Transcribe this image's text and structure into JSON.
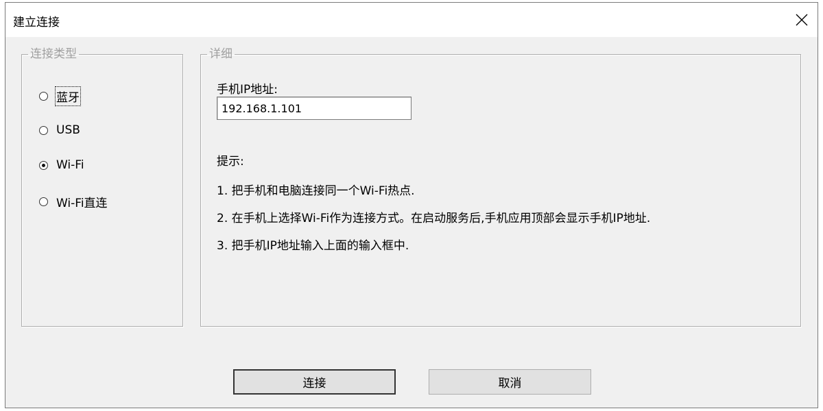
{
  "window": {
    "title": "建立连接"
  },
  "connection_type": {
    "legend": "连接类型",
    "options": [
      {
        "label": "蓝牙",
        "selected": false
      },
      {
        "label": "USB",
        "selected": false
      },
      {
        "label": "Wi-Fi",
        "selected": true
      },
      {
        "label": "Wi-Fi直连",
        "selected": false
      }
    ]
  },
  "details": {
    "legend": "详细",
    "ip_label": "手机IP地址:",
    "ip_value": "192.168.1.101",
    "hint_title": "提示:",
    "hints": [
      "1. 把手机和电脑连接同一个Wi-Fi热点.",
      "2. 在手机上选择Wi-Fi作为连接方式。在启动服务后,手机应用顶部会显示手机IP地址.",
      "3. 把手机IP地址输入上面的输入框中."
    ]
  },
  "buttons": {
    "connect": "连接",
    "cancel": "取消"
  },
  "icons": {
    "close": "close-icon",
    "radio": "radio-button"
  }
}
